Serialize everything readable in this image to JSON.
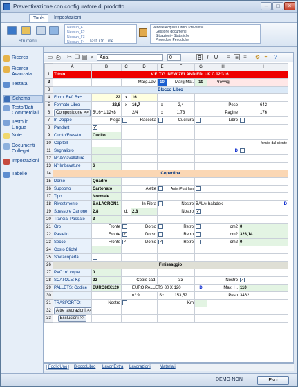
{
  "window": {
    "title": "Preventivazione con configuratore di prodotto"
  },
  "ribbon": {
    "tabs": [
      "Tools",
      "Impostazioni"
    ],
    "strumenti_label": "Strumenti",
    "tasti_label": "Tasti On Line",
    "tasti_items": [
      "Nessun_F1",
      "Nessun_F2",
      "Nessun_F3",
      "Nessun_F4"
    ],
    "tree_items": [
      "Vendite Acquisti Ordini Preventivi",
      "Gestione documenti",
      "Situazioni - Statistiche",
      "Procedure Periodiche"
    ]
  },
  "sidebar": {
    "items": [
      "Ricerca",
      "Ricerca Avanzata",
      "Testata",
      "Schema",
      "Testo/Dati Commerciali",
      "Testo in Lingua",
      "Note",
      "Documenti Collegati",
      "Impostazioni",
      "Tabelle"
    ]
  },
  "toolbar": {
    "font": "Arial",
    "size": "0",
    "icons": [
      "new-icon",
      "print-icon",
      "cut-icon",
      "copy-icon",
      "paste-icon",
      "find-icon",
      "bold-icon",
      "italic-icon",
      "underline-icon",
      "align-left-icon",
      "align-center-icon",
      "align-right-icon",
      "settings-icon",
      "help-icon"
    ]
  },
  "grid": {
    "cols": [
      "A",
      "B",
      "C",
      "D",
      "E",
      "F",
      "G",
      "H",
      "I"
    ],
    "r1": {
      "a": "Titolo",
      "b": "V.F. T.G. NEW ZELAND ED. UK C.02/316"
    },
    "r2": {
      "d": "Marg.Lav.",
      "e": "10",
      "f": "Marg.Mat.",
      "g": "10",
      "h": "Provvig."
    },
    "r3": "Blocco Libro",
    "r4": {
      "a": "Form. Ref. BxH",
      "b": "22",
      "c": "x",
      "d": "16"
    },
    "r5": {
      "a": "Formato Libro",
      "b": "22,8",
      "c": "x",
      "d": "16,7",
      "e": "x",
      "f": "2,4",
      "h": "Peso",
      "i": "642"
    },
    "r6": {
      "a": "Composizione >>",
      "b": "5/16+1/12+8",
      "d": "2/4",
      "e": "x",
      "f": "1,73",
      "h": "Pagine",
      "i": "176"
    },
    "r7": {
      "a": "In Doppio",
      "b": "Piega",
      "d": "Raccolta",
      "f": "Cucitura",
      "h": "Libro"
    },
    "r8": {
      "a": "Pandant"
    },
    "r9": {
      "a": "Cucito/Fresato",
      "b": "Cucito"
    },
    "r10": {
      "a": "Capitelli",
      "h": "fornito dal cliente"
    },
    "r11": {
      "a": "Segnalibro",
      "h": "D"
    },
    "r12": {
      "a": "N° Accavallature"
    },
    "r13": {
      "a": "N° Imbavature",
      "b": "6"
    },
    "r14": "Copertina",
    "r15": {
      "a": "Dorso",
      "b": "Quadro"
    },
    "r16": {
      "a": "Supporto",
      "b": "Cartonato",
      "d": "Alette",
      "f": "Anter/Post Iam"
    },
    "r17": {
      "a": "Tipo",
      "b": "Normale"
    },
    "r18": {
      "a": "Rivestimento",
      "b": "BALACRON1",
      "d": "In Fibra",
      "f": "Nostro",
      "g": "BALACRON",
      "h": "baladek",
      "i": "D"
    },
    "r19": {
      "a": "Spessore Cartone",
      "b": "2,8",
      "c": "d.",
      "d": "2,8",
      "f": "Nostro"
    },
    "r20": {
      "a": "Trancia:",
      "a2": "Passate",
      "b": "3"
    },
    "r21": {
      "a": "Oro",
      "b": "Fronte",
      "d": "Dorso",
      "f": "Retro",
      "h": "cm2",
      "i": "0"
    },
    "r22": {
      "a": "Pastello",
      "b": "Fronte",
      "d": "Dorso",
      "f": "Retro",
      "h": "cm2",
      "i": "323,14"
    },
    "r23": {
      "a": "Secco",
      "b": "Fronte",
      "d": "Dorso",
      "f": "Retro",
      "h": "cm2",
      "i": "0"
    },
    "r24": {
      "a": "Costo Cliché"
    },
    "r25": {
      "a": "Sovracoperta"
    },
    "r26": "Finissaggio",
    "r27": {
      "a": "PVC: n° copie",
      "b": "0"
    },
    "r28": {
      "a": "SCATOLE:",
      "a2": "Kg",
      "b": "22",
      "d": "Copie cad.",
      "f": "33",
      "h": "Nostro"
    },
    "r29": {
      "a": "PALLETS:",
      "a2": "Codice",
      "b": "EURO80X120",
      "d": "EURO PALLETS 80 X 120",
      "g": "D",
      "h": "Max. H.",
      "i": "110"
    },
    "r30": {
      "d": "n° 9",
      "e": "Sc.",
      "f": "153,52",
      "h": "Peso",
      "i": "3462"
    },
    "r31": {
      "a": "TRASPORTO:",
      "b": "Nostro",
      "f": "Km"
    },
    "r32": {
      "a": "Altre lavorazioni >>"
    },
    "r33": {
      "a": "Esclusioni >>"
    }
  },
  "sheets": [
    "FoglioUno",
    "BloccoLibro",
    "LavoriExtra",
    "Lavorazioni",
    "Materiali"
  ],
  "status": {
    "text": "DEMO-NON",
    "exit": "Esci"
  }
}
